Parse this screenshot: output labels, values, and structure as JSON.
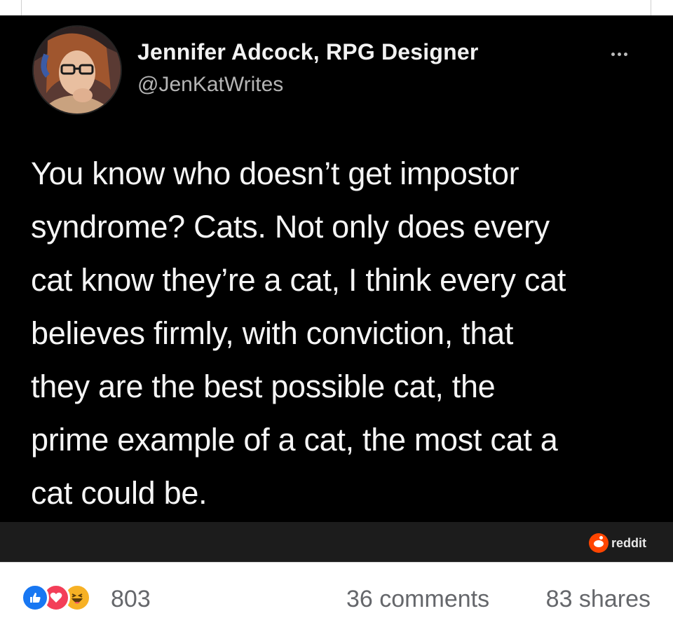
{
  "tweet": {
    "author_name": "Jennifer Adcock, RPG Designer",
    "author_handle": "@JenKatWrites",
    "more_icon": "more-horizontal-icon",
    "text_lines": [
      "You know who doesn’t get impostor",
      "syndrome? Cats. Not only does every",
      "cat know they’re a cat, I think every cat",
      "believes firmly, with conviction, that",
      "they are the best possible cat, the",
      "prime example of a cat, the most cat a",
      "cat could be."
    ]
  },
  "watermark": {
    "label": "reddit",
    "icon": "reddit-icon",
    "color": "#ff4500"
  },
  "reactions": {
    "icons": [
      "like-icon",
      "love-icon",
      "haha-icon"
    ],
    "count": "803",
    "comments": "36 comments",
    "shares": "83 shares",
    "colors": {
      "like": "#1877f2",
      "love": "#f33e58",
      "haha": "#f7b125"
    }
  }
}
